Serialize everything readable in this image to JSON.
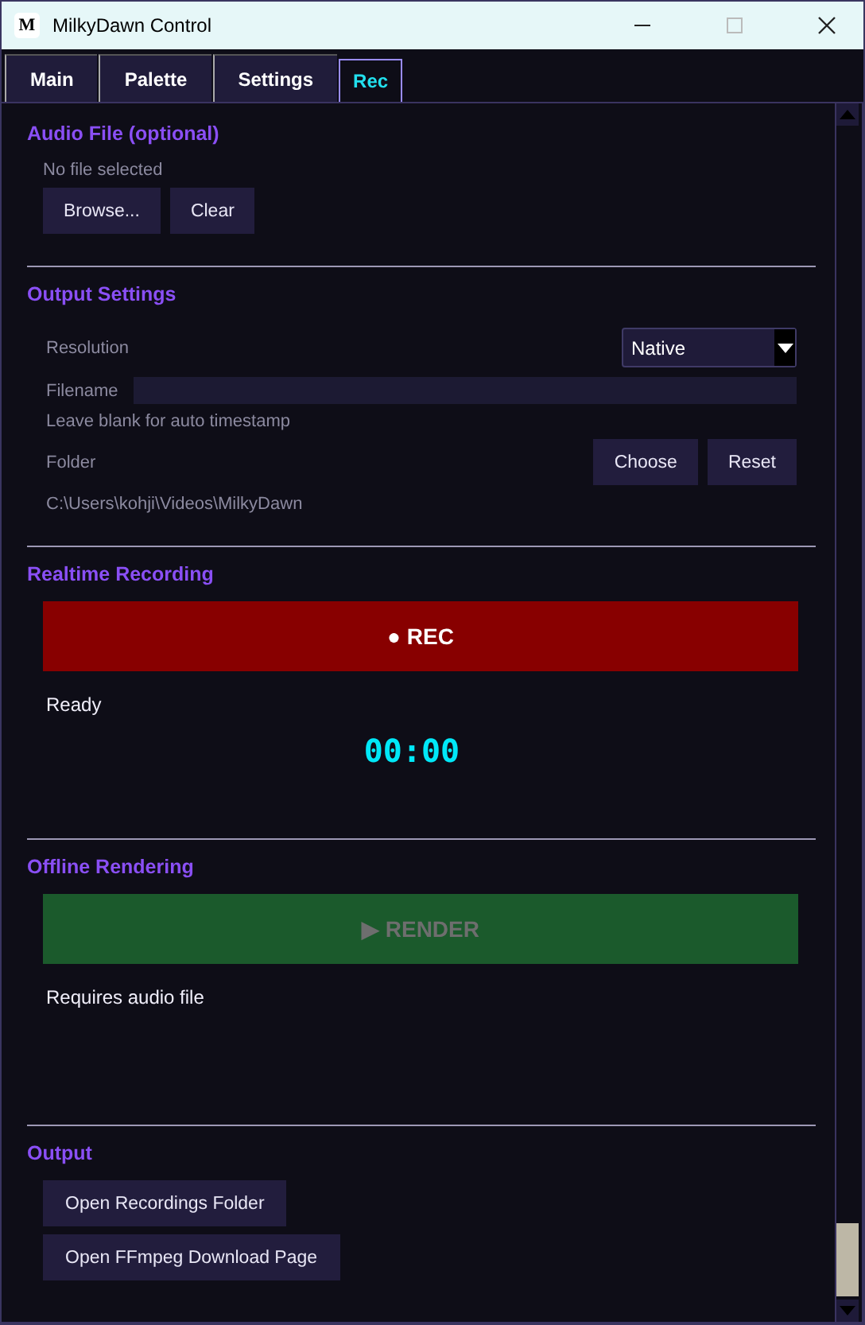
{
  "window": {
    "app_icon": "M",
    "title": "MilkyDawn Control"
  },
  "tabs": [
    {
      "label": "Main",
      "selected": false
    },
    {
      "label": "Palette",
      "selected": false
    },
    {
      "label": "Settings",
      "selected": false
    },
    {
      "label": "Rec",
      "selected": true
    }
  ],
  "audio_file": {
    "heading": "Audio File (optional)",
    "status": "No file selected",
    "buttons": [
      "Browse...",
      "Clear"
    ]
  },
  "output_settings": {
    "heading": "Output Settings",
    "resolution_label": "Resolution",
    "resolution_value": "Native",
    "filename_label": "Filename",
    "filename_hint": "Leave blank for auto timestamp",
    "folder_label": "Folder",
    "folder_buttons": [
      "Choose",
      "Reset"
    ],
    "folder_path": "C:\\Users\\kohji\\Videos\\MilkyDawn"
  },
  "realtime": {
    "heading": "Realtime Recording",
    "button": "● REC",
    "status": "Ready",
    "timer": "00:00"
  },
  "offline": {
    "heading": "Offline Rendering",
    "button": "▶ RENDER",
    "disabled": true,
    "status": "Requires audio file"
  },
  "output": {
    "heading": "Output",
    "buttons": [
      "Open Recordings Folder",
      "Open FFmpeg Download Page"
    ]
  }
}
